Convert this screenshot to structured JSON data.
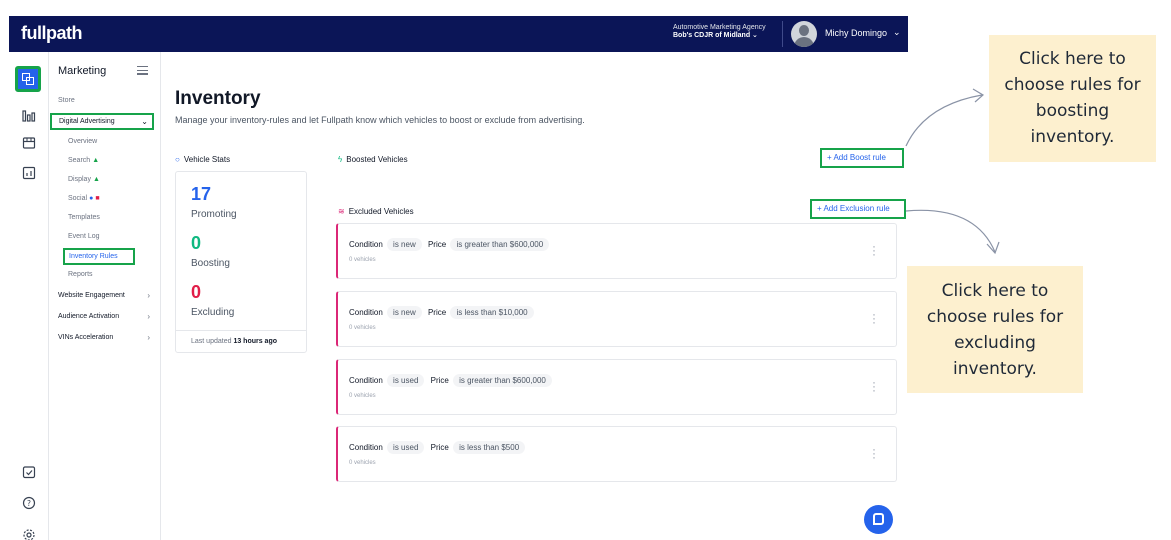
{
  "topbar": {
    "logo": "fullpath",
    "agency_name": "Automotive Marketing Agency",
    "dealer_name": "Bob's CDJR of Midland ⌄",
    "user_name": "Michy Domingo",
    "user_chevron": "⌄"
  },
  "sidenav": {
    "title": "Marketing",
    "store": "Store",
    "digital_advertising": "Digital Advertising",
    "da_chevron": "⌄",
    "sub_items": [
      "Overview",
      "Search",
      "Display",
      "Social",
      "Templates",
      "Event Log"
    ],
    "inventory_rules": "Inventory Rules",
    "reports": "Reports",
    "groups": [
      "Website Engagement",
      "Audience Activation",
      "VINs Acceleration"
    ],
    "group_chevron": "›"
  },
  "main": {
    "title": "Inventory",
    "subtitle": "Manage your inventory-rules and let Fullpath know which vehicles to boost or exclude from advertising."
  },
  "vehicle_stats": {
    "label": "Vehicle Stats",
    "promoting_value": "17",
    "promoting_label": "Promoting",
    "boosting_value": "0",
    "boosting_label": "Boosting",
    "excluding_value": "0",
    "excluding_label": "Excluding",
    "updated_prefix": "Last updated",
    "updated_value": "13 hours ago",
    "colors": {
      "promoting": "#2563eb",
      "boosting": "#10b981",
      "excluding": "#e11d48"
    }
  },
  "boosted": {
    "label": "Boosted Vehicles",
    "button": "+ Add Boost rule"
  },
  "excluded": {
    "label": "Excluded Vehicles",
    "button": "+ Add Exclusion rule",
    "rules": [
      {
        "condition_label": "Condition",
        "condition": "is new",
        "price_label": "Price",
        "price": "is greater than $600,000",
        "count": "0 vehicles"
      },
      {
        "condition_label": "Condition",
        "condition": "is new",
        "price_label": "Price",
        "price": "is less than $10,000",
        "count": "0 vehicles"
      },
      {
        "condition_label": "Condition",
        "condition": "is used",
        "price_label": "Price",
        "price": "is greater than $600,000",
        "count": "0 vehicles"
      },
      {
        "condition_label": "Condition",
        "condition": "is used",
        "price_label": "Price",
        "price": "is less than $500",
        "count": "0 vehicles"
      }
    ]
  },
  "callouts": {
    "boost": [
      "Click here to",
      "choose rules for",
      "boosting",
      "inventory."
    ],
    "exclude": [
      "Click here to",
      "choose rules for",
      "excluding",
      "inventory."
    ]
  },
  "colors": {
    "topbar": "#0b1557",
    "accent": "#2563eb",
    "highlight_border": "#16a34a",
    "exclusion_border": "#db2777",
    "callout_bg": "#fdf0cf"
  }
}
